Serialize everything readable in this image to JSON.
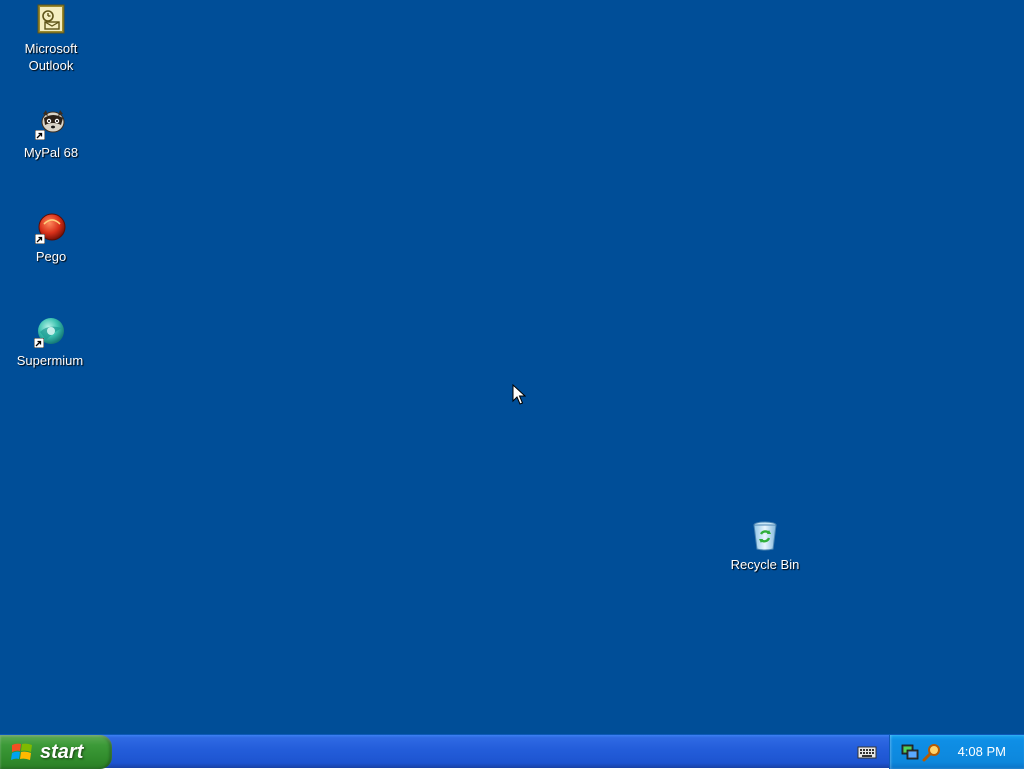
{
  "desktop": {
    "background_color": "#004e98",
    "icons": [
      {
        "label": "Microsoft\nOutlook",
        "icon": "outlook-icon"
      },
      {
        "label": "MyPal 68",
        "icon": "mypal-icon"
      },
      {
        "label": "Pego",
        "icon": "pego-icon"
      },
      {
        "label": "Supermium",
        "icon": "supermium-icon"
      },
      {
        "label": "Recycle Bin",
        "icon": "recycle-bin-icon"
      }
    ]
  },
  "taskbar": {
    "start_label": "start",
    "start_icon": "windows-logo-icon",
    "quick_icon": "keyboard-icon",
    "tray_icons": [
      "network-icon",
      "search-icon"
    ],
    "clock": "4:08 PM",
    "colors": {
      "start_green": "#3c9a38",
      "taskbar_blue": "#245edb",
      "tray_blue": "#0d87dc"
    }
  }
}
